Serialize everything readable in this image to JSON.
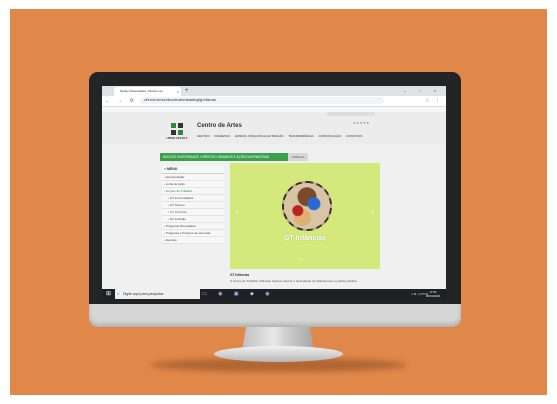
{
  "browser": {
    "tab_title": "Núcleo Diversidade, Direitos Hu",
    "tab_close": "×",
    "new_tab": "+",
    "window_controls": "–  ▫  ×",
    "nav_icons": "←  →  ⟳  ⌂",
    "url": "ufrb.edu.br/cecult/nucleodiversidade/gt/gt-infancias",
    "ext_icons": "☆ ⋮"
  },
  "site": {
    "gov_bar": "",
    "logo_text": "UFRB CECULT",
    "title": "Centro de Artes",
    "nav": [
      "CENTRO",
      "INGRESSO",
      "ENSINO, PESQUISA E EXTENSÃO",
      "TRANSPARÊNCIA",
      "COMUNICAÇÃO",
      "CONTATOS"
    ],
    "social": "●●●●●",
    "strip": "NÚCLEO DIVERSIDADE, DIREITOS HUMANOS E AÇÕES AFIRMATIVAS",
    "strip_tag": "NDDHAA"
  },
  "menu": {
    "heading": "≡ MENU",
    "items": [
      {
        "label": "› Apresentação",
        "level": 0
      },
      {
        "label": "› Linha de Ação",
        "level": 0
      },
      {
        "label": "› Grupos de Trabalho",
        "level": 0,
        "active": true
      },
      {
        "label": "› GT Comunidades",
        "level": 1
      },
      {
        "label": "› GT Gênero",
        "level": 1
      },
      {
        "label": "› GT Infâncias",
        "level": 1,
        "active": true
      },
      {
        "label": "› GT Inclusão",
        "level": 1
      },
      {
        "label": "› Programa Diversidade",
        "level": 0
      },
      {
        "label": "› Programa e Projetos de extensão",
        "level": 0
      },
      {
        "label": "› Eventos",
        "level": 0
      }
    ]
  },
  "carousel": {
    "caption": "GT Infâncias",
    "prev": "‹",
    "next": "›",
    "dots": "•"
  },
  "content": {
    "title": "GT Infâncias",
    "text": "O Grupo de Trabalho Infâncias objetiva discutir a diversidade da infância face à política pública..."
  },
  "taskbar": {
    "search_placeholder": "Digite aqui para pesquisar",
    "search_icon": "○",
    "windows_icon": "⊞",
    "apps": "▭ ◉ ▣ ◆ ◉",
    "tray": "∧  ⊏  ◁)  POR",
    "time": "17:52",
    "date": "06/01/2020"
  },
  "colors": {
    "background": "#e0884a",
    "accent_green": "#3aa04a",
    "carousel_bg": "#d4e87c"
  }
}
